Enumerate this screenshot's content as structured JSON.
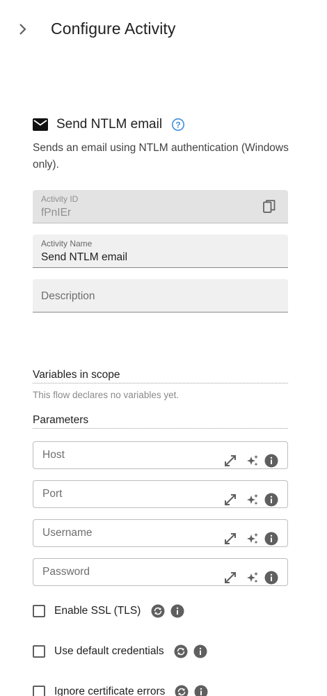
{
  "header": {
    "title": "Configure Activity"
  },
  "activity": {
    "title": "Send NTLM email",
    "description": "Sends an email using NTLM authentication (Windows only)."
  },
  "fields": {
    "activity_id": {
      "label": "Activity ID",
      "value": "fPnIEr"
    },
    "activity_name": {
      "label": "Activity Name",
      "value": "Send NTLM email"
    },
    "description": {
      "placeholder": "Description"
    }
  },
  "variables": {
    "title": "Variables in scope",
    "empty_note": "This flow declares no variables yet."
  },
  "parameters": {
    "title": "Parameters",
    "inputs": [
      {
        "placeholder": "Host"
      },
      {
        "placeholder": "Port"
      },
      {
        "placeholder": "Username"
      },
      {
        "placeholder": "Password"
      }
    ],
    "checkboxes": [
      {
        "label": "Enable SSL (TLS)",
        "checked": false
      },
      {
        "label": "Use default credentials",
        "checked": false
      },
      {
        "label": "Ignore certificate errors",
        "checked": false
      }
    ]
  },
  "colors": {
    "accent": "#3d8fd9",
    "icon_gray": "#5f5f5f",
    "field_bg": "#f0f0f0"
  }
}
